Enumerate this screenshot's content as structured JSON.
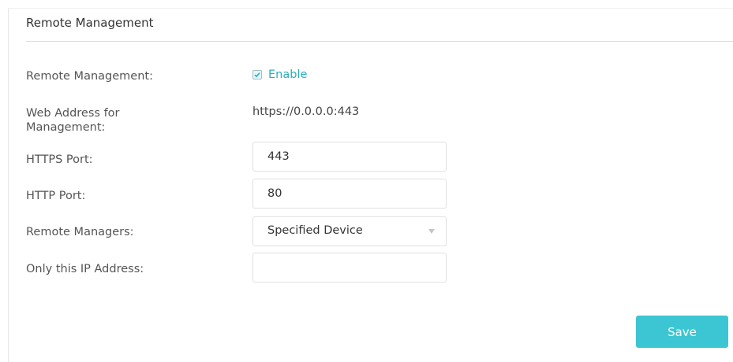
{
  "section": {
    "title": "Remote Management"
  },
  "form": {
    "remote_management": {
      "label": "Remote Management:",
      "checkbox_label": "Enable",
      "checked": true
    },
    "web_address": {
      "label_line1": "Web Address for",
      "label_line2": "Management:",
      "value": "https://0.0.0.0:443"
    },
    "https_port": {
      "label": "HTTPS Port:",
      "value": "443"
    },
    "http_port": {
      "label": "HTTP Port:",
      "value": "80"
    },
    "remote_managers": {
      "label": "Remote Managers:",
      "selected": "Specified Device"
    },
    "ip_address": {
      "label": "Only this IP Address:",
      "value": ""
    }
  },
  "actions": {
    "save_label": "Save"
  },
  "colors": {
    "accent": "#3cc6d3",
    "enable_text": "#2aaeb8"
  },
  "icons": {
    "checkbox": "checkmark-icon",
    "select_arrow": "chevron-down-icon"
  }
}
